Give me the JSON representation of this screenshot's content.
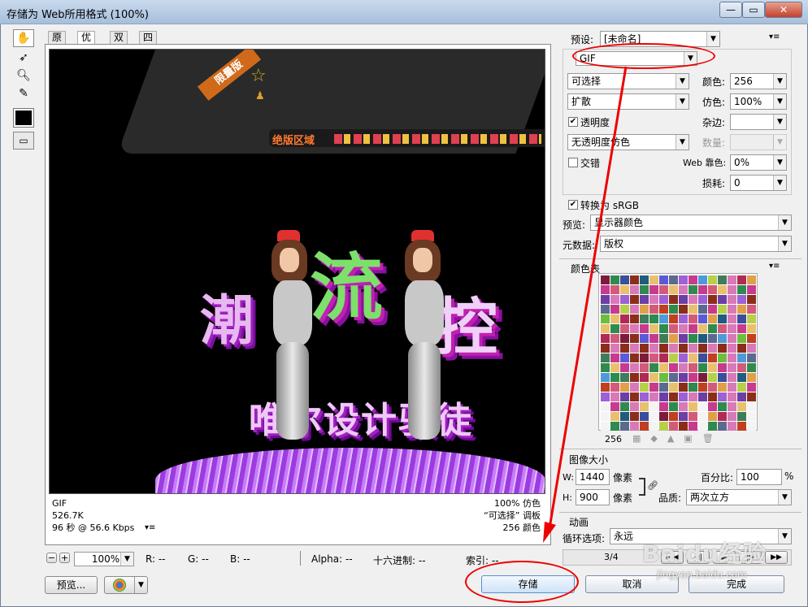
{
  "window": {
    "title": "存储为 Web所用格式 (100%)",
    "min_label": "—",
    "max_label": "▭",
    "close_label": "✕"
  },
  "tabs": [
    "原稿",
    "优化",
    "双联",
    "四联"
  ],
  "banner": {
    "badge": "限量版",
    "menu": "绝版区域"
  },
  "artwork": {
    "word1": "潮",
    "word2": "流",
    "word3": "控",
    "slogan": "唯尔设计驭徒"
  },
  "info": {
    "format": "GIF",
    "size": "526.7K",
    "time": "96 秒 @ 56.6 Kbps",
    "dither": "100% 仿色",
    "palette": "“可选择” 调板",
    "colors": "256 颜色"
  },
  "status": {
    "zoom": "100%",
    "r": "R: --",
    "g": "G: --",
    "b": "B: --",
    "alpha": "Alpha: --",
    "hex": "十六进制: --",
    "index": "索引: --"
  },
  "preview_button": "预览...",
  "settings": {
    "preset_label": "预设:",
    "preset_value": "[未命名]",
    "format_value": "GIF",
    "reduction_value": "可选择",
    "colors_label": "颜色:",
    "colors_value": "256",
    "dither_algo_value": "扩散",
    "dither_label": "仿色:",
    "dither_value": "100%",
    "transparency_label": "透明度",
    "matte_label": "杂边:",
    "trans_dither_value": "无透明度仿色",
    "amount_label": "数量:",
    "interlaced_label": "交错",
    "websnap_label": "Web 靠色:",
    "websnap_value": "0%",
    "lossy_label": "损耗:",
    "lossy_value": "0",
    "srgb_label": "转换为 sRGB",
    "preview_label": "预览:",
    "preview_value": "显示器颜色",
    "metadata_label": "元数据:",
    "metadata_value": "版权"
  },
  "color_table": {
    "title": "颜色表",
    "count": "256",
    "colors": [
      "#7d1c3a",
      "#5c6a8e",
      "#b02a55",
      "#2f8a4d",
      "#9c61d4",
      "#e0a04a",
      "#3a4f9c",
      "#c73b8e",
      "#6cbf3e",
      "#8a2e1a",
      "#4e9ad8",
      "#d25b7a",
      "#1f5c7e",
      "#b7d04a",
      "#6b3fa5",
      "#e8c06e",
      "#3e7c5a",
      "#c04020",
      "#5a5ad8",
      "#d87ab8"
    ]
  },
  "image_size": {
    "title": "图像大小",
    "w_label": "W:",
    "w_value": "1440",
    "h_label": "H:",
    "h_value": "900",
    "unit": "像素",
    "percent_label": "百分比:",
    "percent_value": "100",
    "percent_unit": "%",
    "quality_label": "品质:",
    "quality_value": "两次立方"
  },
  "animation": {
    "title": "动画",
    "loop_label": "循环选项:",
    "loop_value": "永远",
    "frame": "3/4"
  },
  "buttons": {
    "save": "存储",
    "cancel": "取消",
    "done": "完成"
  },
  "watermark": "Baidu经验",
  "watermark_url": "jingyan.baidu.com"
}
